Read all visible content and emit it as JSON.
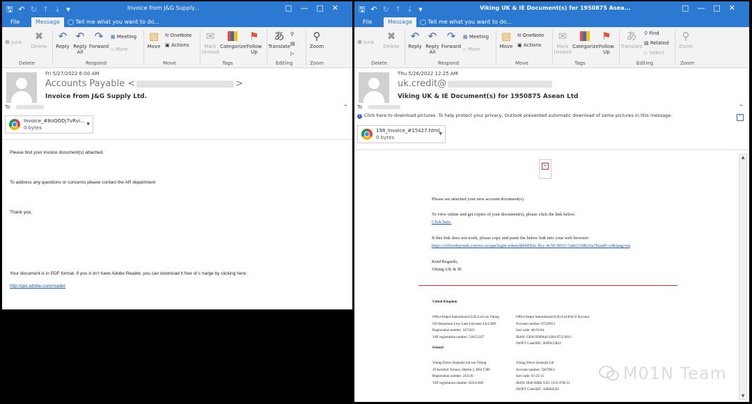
{
  "left_window": {
    "title": "Invoice from J&G Supply...",
    "tabs": {
      "file": "File",
      "message": "Message"
    },
    "tell_me": "Tell me what you want to do...",
    "ribbon": {
      "junk": "Junk",
      "delete": "Delete",
      "reply": "Reply",
      "reply_all": "Reply All",
      "forward": "Forward",
      "meeting": "Meeting",
      "more": "More",
      "move": "Move",
      "onenote": "OneNote",
      "actions": "Actions",
      "mark_unread": "Mark Unread",
      "categorize": "Categorize",
      "follow_up": "Follow Up",
      "translate": "Translate",
      "zoom": "Zoom",
      "group_delete": "Delete",
      "group_respond": "Respond",
      "group_move": "Move",
      "group_tags": "Tags",
      "group_editing": "Editing",
      "group_zoom": "Zoom"
    },
    "header": {
      "date": "Fri 5/27/2022 6:00 AM",
      "sender_name": "Accounts Payable <",
      "sender_end": ">",
      "subject": "Invoice from J&G Supply Ltd.",
      "to_label": "To"
    },
    "attachment": {
      "name": "Invoice_#8oQODj7vRvi...",
      "size": "0 bytes"
    },
    "body": {
      "line1": "Please find your invoice document(s) attached.",
      "line2": "To address any questions or concerns please contact the AR department",
      "line3": "Thank you,",
      "line4": "Your document is in PDF format. If you d on't have Adobe Reader, you can download it free of c harge by clicking here:",
      "link": "http://get.adobe.com/reader"
    }
  },
  "right_window": {
    "title": "Viking UK & IE Document(s) for 1950875 Asea...",
    "tabs": {
      "file": "File",
      "message": "Message"
    },
    "tell_me": "Tell me what you want to do...",
    "ribbon": {
      "junk": "Junk",
      "delete": "Delete",
      "reply": "Reply",
      "reply_all": "Reply All",
      "forward": "Forward",
      "meeting": "Meeting",
      "more": "More",
      "move": "Move",
      "onenote": "OneNote",
      "actions": "Actions",
      "mark_unread": "Mark Unread",
      "categorize": "Categorize",
      "follow_up": "Follow Up",
      "translate": "Translate",
      "find": "Find",
      "related": "Related",
      "select": "Select",
      "zoom": "Zoom",
      "group_delete": "Delete",
      "group_respond": "Respond",
      "group_move": "Move",
      "group_tags": "Tags",
      "group_editing": "Editing",
      "group_zoom": "Zoom"
    },
    "header": {
      "date": "Thu 5/26/2022 12:25 AM",
      "sender_name": "uk.credit@",
      "subject": "Viking UK & IE Document(s) for 1950875 Asean Ltd",
      "to_label": "To",
      "info_bar": "Click here to download pictures. To help protect your privacy, Outlook prevented automatic download of some pictures in this message."
    },
    "attachment": {
      "name": "198_Invoice_#15427.html",
      "size": "0 bytes"
    },
    "body": {
      "line1": "Please see attached your new account document(s).",
      "line2": "To view online and get copies of your document(s), please click the link below:",
      "link1": "Click here.",
      "line3": "If this link does not work, please copy and paste the below link into your web browser:",
      "link2": "https://officedepotuk.corrivo.io/app/login-token/8d4d5bfc-ffcc-4c50-9052-7ade2160b26a?brand=vi&lang=en",
      "line4": "Kind Regards,",
      "line5": "Viking UK & IE"
    },
    "footer": {
      "uk_heading": "United Kingdom",
      "uk_left": [
        "Office Depot International (UK) Ltd t/as Viking",
        "501 Beaumont Leys Lane Leicester LE4 2BN",
        "Registration number: 2472621",
        "VAT registration number: 538153357"
      ],
      "uk_right": [
        "Office Depot International (UK) Ltd BACS Account",
        "Account number: 87529013",
        "Sort code: 40-03-84",
        "IBAN: GB36 BNPA40 6384 8752 9013",
        "SWIFT Code/BIC: BNPA GB22"
      ],
      "ie_heading": "Ireland",
      "ie_left": [
        "Viking Direct (Ireland) Ltd t/as Viking",
        "10 Earlsfort Terrace, Dublin 2, D02 T380",
        "Registration number: 243136",
        "VAT registration number: 8243136D"
      ],
      "ie_right": [
        "Viking Direct (Ireland) Ltd",
        "Account number: 59470051",
        "Sort code: 93-25-15",
        "IBAN: IE60 AIBK 9325 1559 4700 51",
        "SWIFT Code/BIC: AIBKIE2D"
      ]
    }
  },
  "watermark": "M01N Team",
  "colors": {
    "titlebar": "#2b79d0",
    "link": "#1a55c9",
    "separator_red": "#d62d2d"
  }
}
